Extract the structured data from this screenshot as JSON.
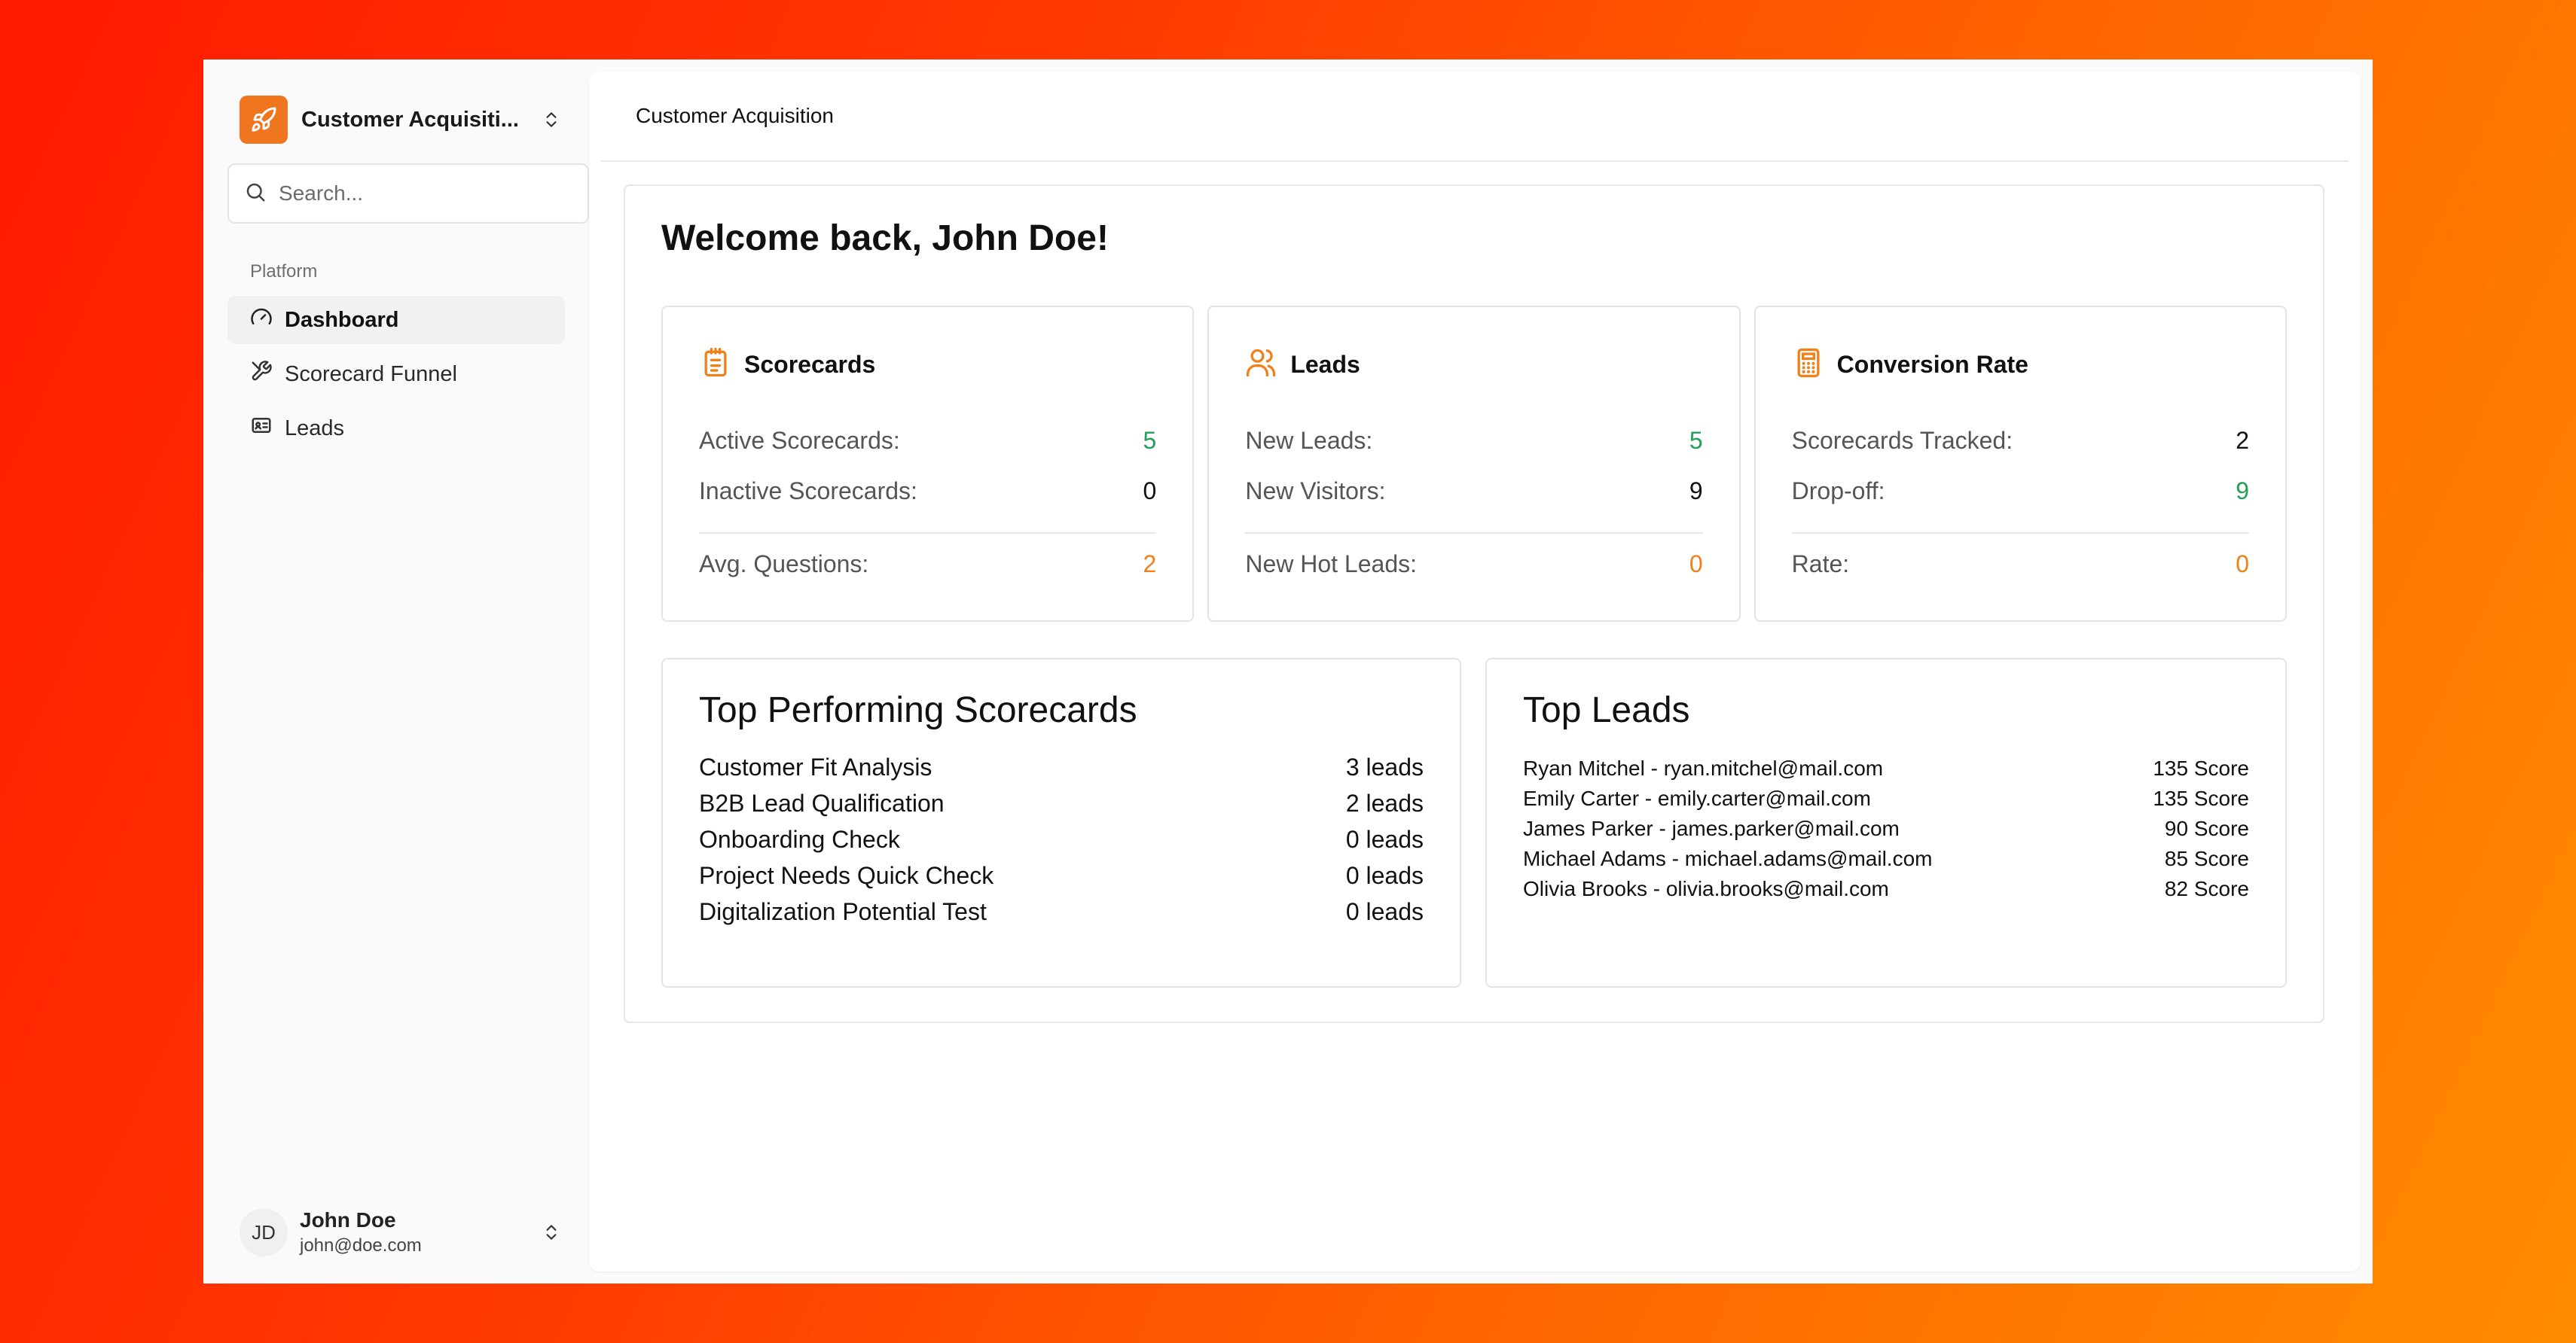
{
  "sidebar": {
    "brand_name": "Customer Acquisiti...",
    "search_placeholder": "Search...",
    "section_label": "Platform",
    "items": [
      {
        "label": "Dashboard",
        "icon": "gauge-icon",
        "active": true
      },
      {
        "label": "Scorecard Funnel",
        "icon": "funnel-icon",
        "active": false
      },
      {
        "label": "Leads",
        "icon": "id-card-icon",
        "active": false
      }
    ],
    "user": {
      "initials": "JD",
      "name": "John Doe",
      "email": "john@doe.com"
    }
  },
  "header": {
    "breadcrumb": "Customer Acquisition"
  },
  "main": {
    "welcome": "Welcome back, John Doe!",
    "cards": [
      {
        "title": "Scorecards",
        "icon": "clipboard-icon",
        "rows": [
          {
            "label": "Active Scorecards:",
            "value": "5",
            "color": "#22a05a"
          },
          {
            "label": "Inactive Scorecards:",
            "value": "0",
            "color": "#111111"
          }
        ],
        "footer": {
          "label": "Avg. Questions:",
          "value": "2",
          "color": "#f08019"
        }
      },
      {
        "title": "Leads",
        "icon": "users-icon",
        "rows": [
          {
            "label": "New Leads:",
            "value": "5",
            "color": "#22a05a"
          },
          {
            "label": "New Visitors:",
            "value": "9",
            "color": "#111111"
          }
        ],
        "footer": {
          "label": "New Hot Leads:",
          "value": "0",
          "color": "#f08019"
        }
      },
      {
        "title": "Conversion Rate",
        "icon": "calculator-icon",
        "rows": [
          {
            "label": "Scorecards Tracked:",
            "value": "2",
            "color": "#111111"
          },
          {
            "label": "Drop-off:",
            "value": "9",
            "color": "#22a05a"
          }
        ],
        "footer": {
          "label": "Rate:",
          "value": "0",
          "color": "#f08019"
        }
      }
    ],
    "top_scorecards": {
      "title": "Top Performing Scorecards",
      "items": [
        {
          "name": "Customer Fit Analysis",
          "leads": "3 leads"
        },
        {
          "name": "B2B Lead Qualification",
          "leads": "2 leads"
        },
        {
          "name": "Onboarding Check",
          "leads": "0 leads"
        },
        {
          "name": "Project Needs Quick Check",
          "leads": "0 leads"
        },
        {
          "name": "Digitalization Potential Test",
          "leads": "0 leads"
        }
      ]
    },
    "top_leads": {
      "title": "Top Leads",
      "items": [
        {
          "name": "Ryan Mitchel - ryan.mitchel@mail.com",
          "score": "135 Score"
        },
        {
          "name": "Emily Carter - emily.carter@mail.com",
          "score": "135 Score"
        },
        {
          "name": "James Parker - james.parker@mail.com",
          "score": "90 Score"
        },
        {
          "name": "Michael Adams - michael.adams@mail.com",
          "score": "85 Score"
        },
        {
          "name": "Olivia Brooks - olivia.brooks@mail.com",
          "score": "82 Score"
        }
      ]
    }
  },
  "colors": {
    "accent": "#f0751f",
    "positive": "#22a05a",
    "warning": "#f08019"
  }
}
